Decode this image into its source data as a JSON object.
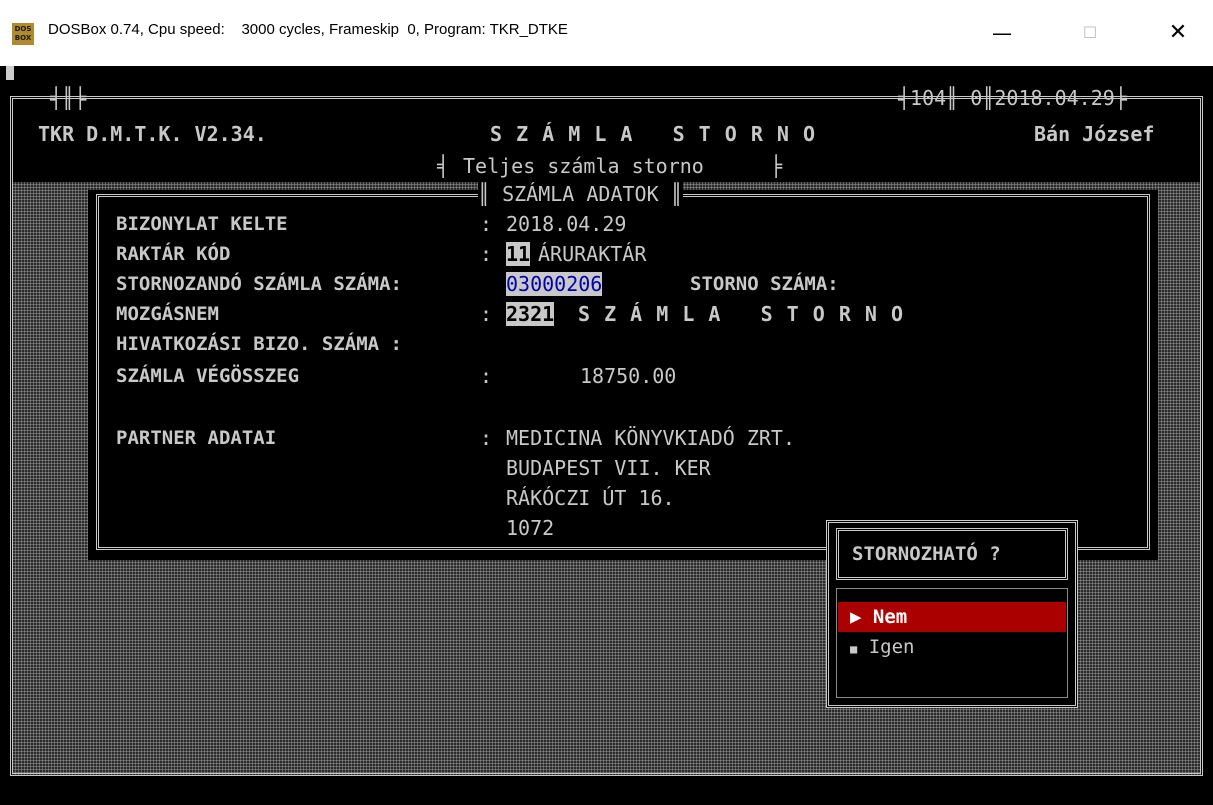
{
  "window": {
    "title": "DOSBox 0.74, Cpu speed:    3000 cycles, Frameskip  0, Program: TKR_DTKE",
    "icon_text": "DOS BOX",
    "controls": {
      "minimize": "—",
      "maximize": "☐",
      "close": "✕"
    }
  },
  "header": {
    "app_name": "TKR D.M.T.K. V2.34.",
    "screen_title": "S Z Á M L A   S T O R N O",
    "counter1": "104",
    "counter2": "0",
    "date": "2018.04.29",
    "user": "Bán József",
    "subtitle": "Teljes számla storno"
  },
  "panel": {
    "title": "SZÁMLA ADATOK",
    "fields": {
      "bizonylat_kelte": {
        "label": "BIZONYLAT KELTE",
        "value": "2018.04.29"
      },
      "raktar_kod": {
        "label": "RAKTÁR KÓD",
        "code": "11",
        "value": "ÁRURAKTÁR"
      },
      "stornozando": {
        "label": "STORNOZANDÓ SZÁMLA SZÁMA:",
        "value": "03000206",
        "storno_label": "STORNO SZÁMA:"
      },
      "mozgasnem": {
        "label": "MOZGÁSNEM",
        "code": "2321",
        "value": "S Z Á M L A   S T O R N O"
      },
      "hivatkozasi": {
        "label": "HIVATKOZÁSI BIZO. SZÁMA :"
      },
      "vegosszeg": {
        "label": "SZÁMLA VÉGÖSSZEG",
        "value": "18750.00"
      },
      "partner": {
        "label": "PARTNER ADATAI",
        "lines": [
          "MEDICINA KÖNYVKIADÓ ZRT.",
          "BUDAPEST VII. KER",
          "RÁKÓCZI ÚT 16.",
          "1072"
        ]
      }
    },
    "colon": ":"
  },
  "dialog": {
    "title": "STORNOZHATÓ ?",
    "options": [
      {
        "marker": "▶",
        "label": "Nem",
        "selected": true
      },
      {
        "marker": "■",
        "label": "Igen",
        "selected": false
      }
    ]
  },
  "colors": {
    "selected_bg": "#aa0000",
    "highlight_text": "#0000aa",
    "text": "#c8c8c8",
    "background": "#000000"
  }
}
